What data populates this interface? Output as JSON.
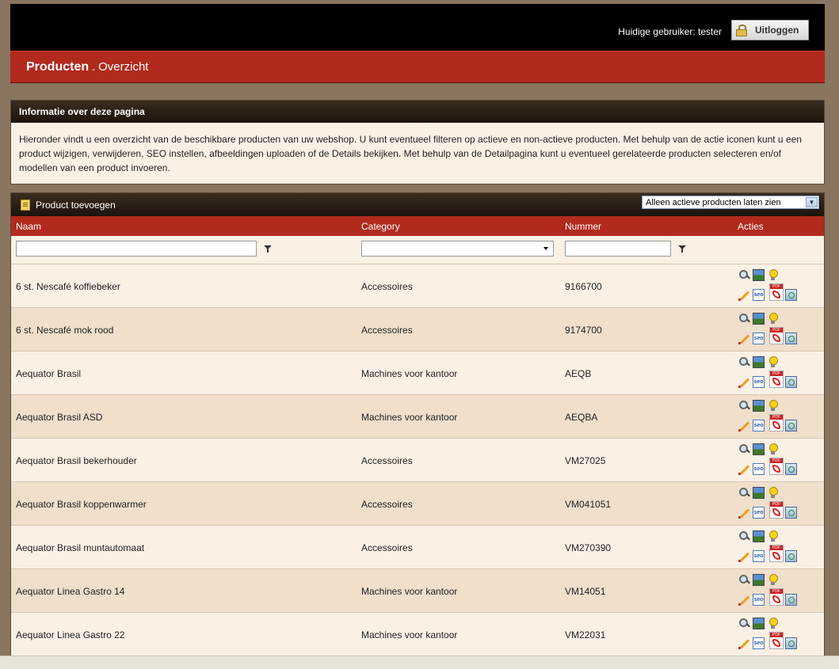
{
  "header": {
    "user_label": "Huidige gebruiker: tester",
    "logout_label": "Uitloggen",
    "title": "Producten",
    "separator": "-",
    "subtitle": "Overzicht"
  },
  "info": {
    "heading": "Informatie over deze pagina",
    "text": "Hieronder vindt u een overzicht van de beschikbare producten van uw webshop. U kunt eventueel filteren op actieve en non-actieve producten. Met behulp van de actie iconen kunt u een product wijzigen, verwijderen, SEO instellen, afbeeldingen uploaden of de Details bekijken. Met behulp van de Detailpagina kunt u eventueel gerelateerde producten selecteren en/of modellen van een product invoeren."
  },
  "grid": {
    "add_label": "Product toevoegen",
    "filter_selected": "Alleen actieve producten laten zien",
    "columns": {
      "name": "Naam",
      "category": "Category",
      "number": "Nummer",
      "actions": "Acties"
    },
    "rows": [
      {
        "name": "6 st. Nescafé koffiebeker",
        "category": "Accessoires",
        "number": "9166700"
      },
      {
        "name": "6 st. Nescafé mok rood",
        "category": "Accessoires",
        "number": "9174700"
      },
      {
        "name": "Aequator Brasil",
        "category": "Machines voor kantoor",
        "number": "AEQB"
      },
      {
        "name": "Aequator Brasil ASD",
        "category": "Machines voor kantoor",
        "number": "AEQBA"
      },
      {
        "name": "Aequator Brasil bekerhouder",
        "category": "Accessoires",
        "number": "VM27025"
      },
      {
        "name": "Aequator Brasil koppenwarmer",
        "category": "Accessoires",
        "number": "VM041051"
      },
      {
        "name": "Aequator Brasil muntautomaat",
        "category": "Accessoires",
        "number": "VM270390"
      },
      {
        "name": "Aequator Linea Gastro 14",
        "category": "Machines voor kantoor",
        "number": "VM14051"
      },
      {
        "name": "Aequator Linea Gastro 22",
        "category": "Machines voor kantoor",
        "number": "VM22031"
      }
    ],
    "action_icons": [
      "view-icon",
      "image-icon",
      "details-bulb-icon",
      "edit-icon",
      "seo-icon",
      "pdf-icon",
      "delete-icon"
    ],
    "seo_text": "seo"
  }
}
